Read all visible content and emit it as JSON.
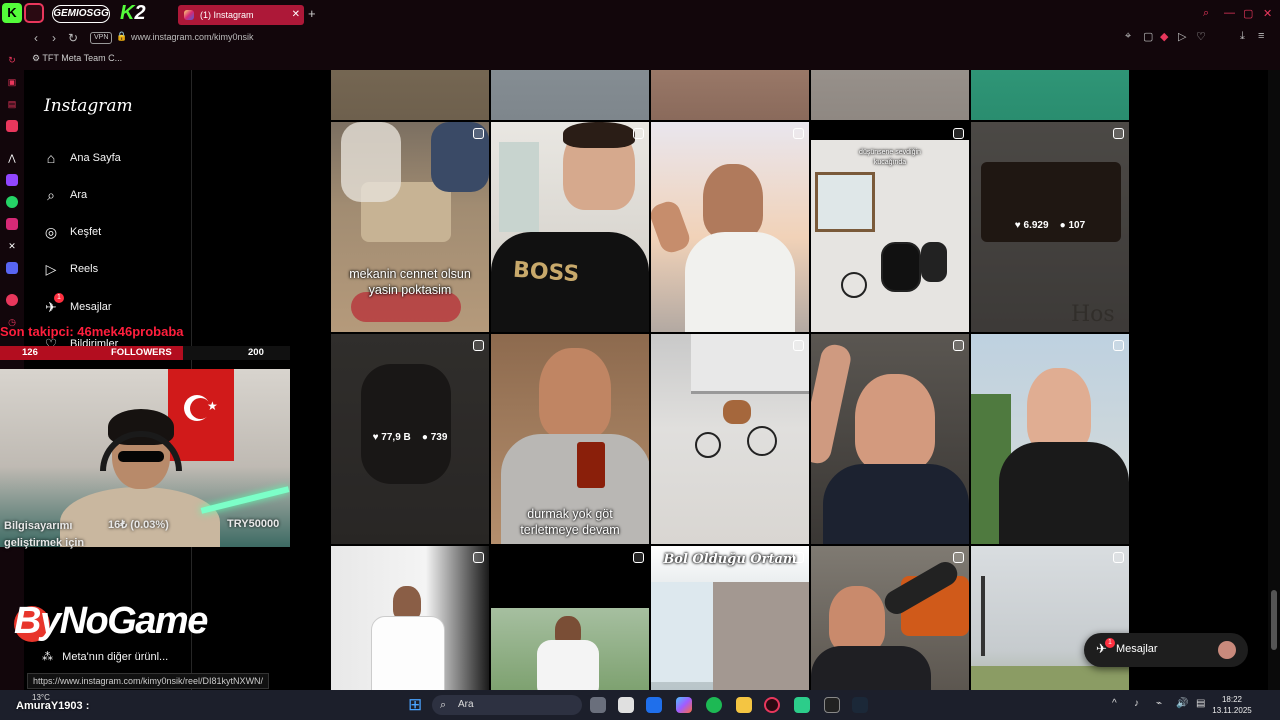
{
  "browser": {
    "tab_title": "(1) Instagram",
    "tab_close": "✕",
    "new_tab": "+",
    "url": "www.instagram.com/kimy0nsik",
    "vpn_label": "VPN",
    "bookmark": "TFT Meta Team C...",
    "status_url": "https://www.instagram.com/kimy0nsik/reel/DI81kytNXWN/",
    "back": "‹",
    "forward": "›",
    "reload": "↻",
    "lock": "🔒"
  },
  "logos": {
    "gemiosgg": "GEMIOSGG",
    "k2_k": "K",
    "k2_num": "2",
    "bynogame": "ByNoGame"
  },
  "window_controls": {
    "search": "⌕",
    "minimize": "—",
    "maximize": "▢",
    "close": "✕"
  },
  "instagram_nav": {
    "logo": "Instagram",
    "items": [
      {
        "label": "Ana Sayfa",
        "icon": "⌂"
      },
      {
        "label": "Ara",
        "icon": "⌕"
      },
      {
        "label": "Keşfet",
        "icon": "◎"
      },
      {
        "label": "Reels",
        "icon": "▷"
      },
      {
        "label": "Mesajlar",
        "icon": "✈",
        "badge": "1"
      },
      {
        "label": "Bildirimler",
        "icon": "♡"
      }
    ],
    "meta_more": "Meta'nın diğer ürünl...",
    "meta_icon": "⁂"
  },
  "grid": {
    "tiles": [
      {
        "caption": "mekanin cennet olsun\nyasin poktasim"
      },
      {
        "stats_likes": "6.929",
        "stats_comments": "107",
        "caption_small": "düşünsene sevdiğin\nkucağında"
      },
      {
        "stats_likes": "77,9 B",
        "stats_comments": "739"
      },
      {
        "caption": "durmak yok göt\nterletmeye devam"
      },
      {
        "caption": "Bol Olduğu Ortam"
      }
    ],
    "like_icon": "♥",
    "comment_icon": "●"
  },
  "stream": {
    "last_follower": "Son takipci: 46mek46probaba",
    "follow_current": "126",
    "follow_label": "FOLLOWERS",
    "follow_goal": "200",
    "follow_progress": 0.63,
    "cam_left": "Bilgisayarımı\ngeliştirmek için",
    "cam_mid": "16₺ (0.03%)",
    "cam_right": "TRY50000",
    "ticker": "AmuraY1903 :",
    "weather": "13°C",
    "flag_star": "★"
  },
  "messages_pill": {
    "label": "Mesajlar",
    "badge": "1",
    "icon": "✈"
  },
  "taskbar": {
    "search_label": "Ara",
    "search_icon": "⌕",
    "time": "18:22",
    "date": "13.11.2025",
    "windows_icon": "⊞",
    "tray": [
      "^",
      "♪",
      "⌁",
      "🔊",
      "▤"
    ]
  },
  "colors": {
    "accent": "#ad1838",
    "instagram_badge": "#ff3040",
    "follower_red": "#ff1f3d",
    "background": "#000000"
  }
}
